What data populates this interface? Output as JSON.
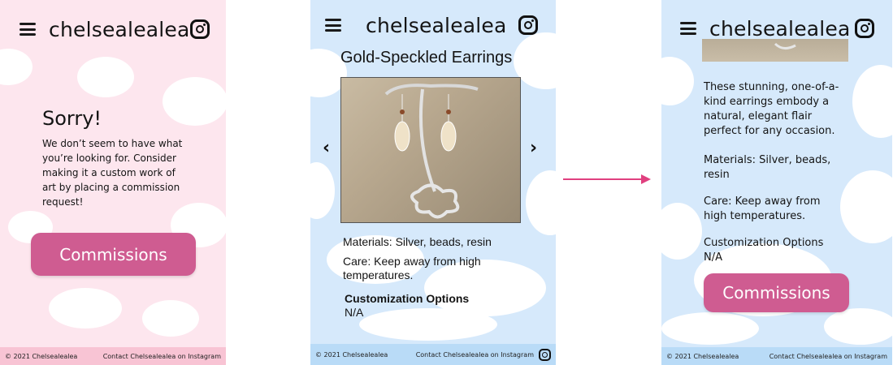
{
  "brand": "chelsealealea",
  "screen_sorry": {
    "title": "Sorry!",
    "message": "We don’t seem to have what you’re looking for. Consider making it a custom work of art by placing a commission request!",
    "button": "Commissions",
    "footer_left": "© 2021 Chelsealealea",
    "footer_right": "Contact Chelsealealea on Instagram"
  },
  "screen_product": {
    "title": "Gold-Speckled Earrings",
    "materials": "Materials: Silver, beads, resin",
    "care": "Care: Keep away from high temperatures.",
    "custom_heading": "Customization Options",
    "custom_value": "N/A",
    "prev_glyph": "‹",
    "next_glyph": "›",
    "footer_left": "© 2021 Chelsealealea",
    "footer_right": "Contact Chelsealealea on Instagram"
  },
  "screen_detail": {
    "description": "These stunning, one-of-a-kind earrings embody a natural, elegant flair perfect for any occasion.",
    "materials": "Materials: Silver, beads, resin",
    "care": "Care: Keep away from high temperatures.",
    "custom_heading": "Customization Options",
    "custom_value": "N/A",
    "button": "Commissions",
    "footer_left": "© 2021 Chelsealealea",
    "footer_right": "Contact Chelsealealea on Instagram"
  },
  "colors": {
    "pink_accent": "#cf5c91",
    "pink_bg": "#fde6ee",
    "blue_bg": "#d6e9fb",
    "arrow": "#e0407f"
  },
  "icons": {
    "menu": "hamburger-menu-icon",
    "instagram": "instagram-icon",
    "prev": "chevron-left-icon",
    "next": "chevron-right-icon"
  }
}
